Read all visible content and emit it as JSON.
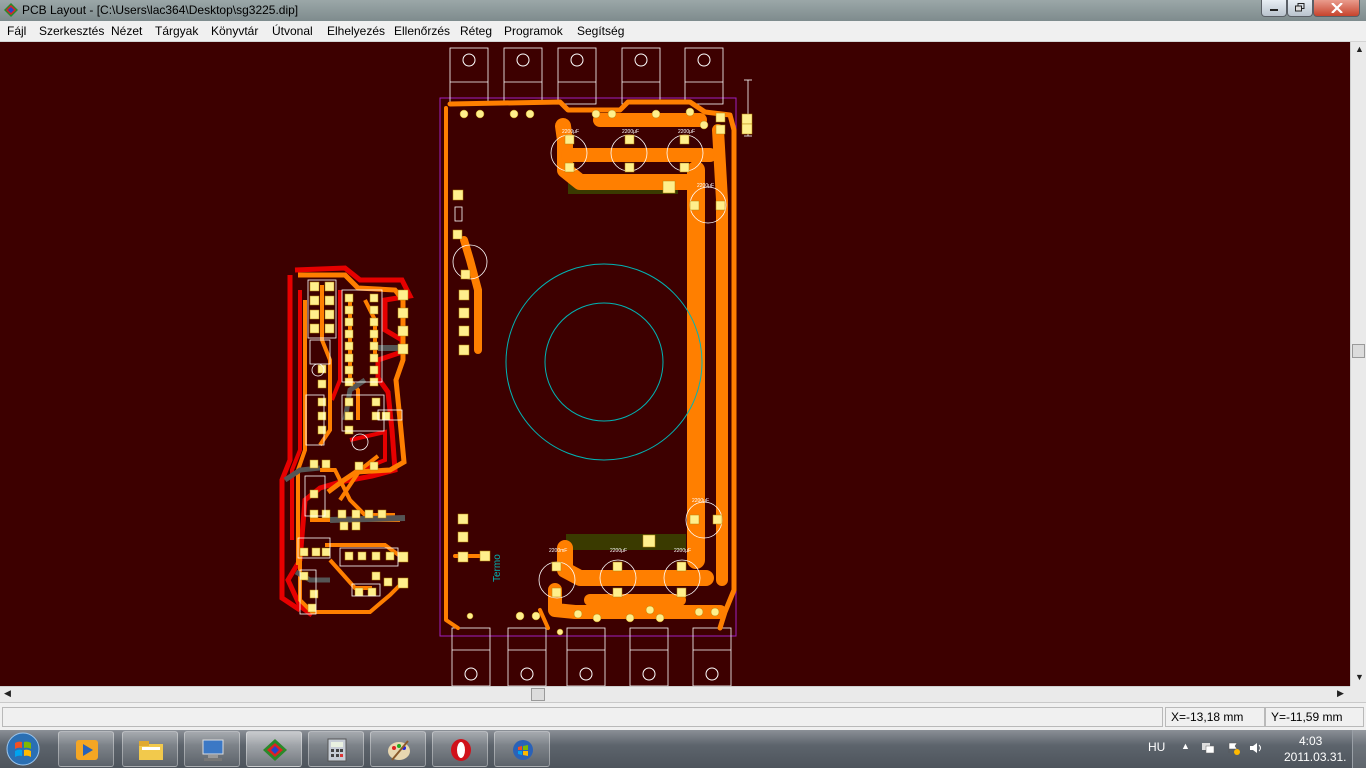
{
  "window": {
    "title": "PCB Layout - [C:\\Users\\lac364\\Desktop\\sg3225.dip]"
  },
  "menu": [
    "Fájl",
    "Szerkesztés",
    "Nézet",
    "Tárgyak",
    "Könyvtár",
    "Útvonal",
    "Elhelyezés",
    "Ellenőrzés",
    "Réteg",
    "Programok",
    "Segítség"
  ],
  "board": {
    "label_termo": "Termo",
    "cap_labels_top": [
      "2200μF",
      "2200μF",
      "2200μF"
    ],
    "cap_label_right_top": "2200μF",
    "cap_label_right_bottom": "2200μF",
    "cap_labels_bottom": [
      "2200mF",
      "2200μF",
      "2200μF"
    ]
  },
  "status": {
    "x_coord": "X=-13,18 mm",
    "y_coord": "Y=-11,59 mm"
  },
  "taskbar": {
    "language": "HU",
    "time": "4:03",
    "date": "2011.03.31."
  },
  "icons": {
    "app": "pcb-layout-app-icon",
    "start": "windows-start-icon"
  },
  "colors": {
    "canvas": "#3d0000",
    "trace_top": "#ff7f00",
    "trace_bottom": "#e60000",
    "pad": "#ffef8c",
    "silkscreen": "#ffffff",
    "outline": "#00c8c8",
    "board_edge": "#a020c0"
  }
}
